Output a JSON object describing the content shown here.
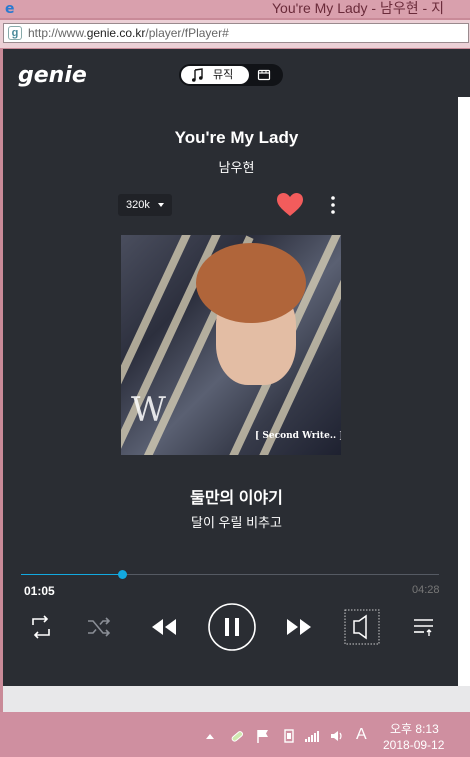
{
  "window": {
    "title": "You're My Lady - 남우현 - 지"
  },
  "address_bar": {
    "url_prefix": "http://www.",
    "url_domain": "genie.co.kr",
    "url_path": "/player/fPlayer#"
  },
  "header": {
    "logo": "genie",
    "tab_music_label": "뮤직",
    "tab_music_icon": "music-note-icon",
    "tab_video_icon": "video-icon"
  },
  "song": {
    "title": "You're My Lady",
    "artist": "남우현"
  },
  "options": {
    "quality": "320k",
    "liked": true,
    "accent_color": "#f25c5c"
  },
  "album_art": {
    "monogram": "W",
    "album_text": "[ Second Write.. ]"
  },
  "lyrics": {
    "current": "둘만의 이야기",
    "next": "달이 우릴 비추고"
  },
  "progress": {
    "current_time": "01:05",
    "duration": "04:28",
    "fraction": 0.242,
    "color": "#12a9e0"
  },
  "controls": [
    "repeat-icon",
    "shuffle-icon",
    "previous-icon",
    "pause-icon",
    "next-icon",
    "equalizer-icon",
    "playlist-icon"
  ],
  "taskbar": {
    "time": "오후 8:13",
    "date": "2018-09-12",
    "ime": "A"
  }
}
